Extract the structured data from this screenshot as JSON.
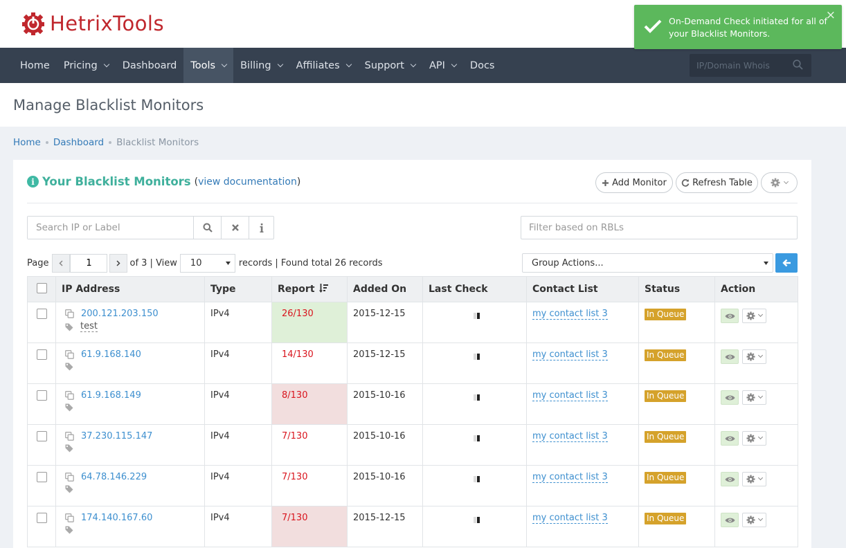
{
  "brand": {
    "name": "HetrixTools",
    "primary_color": "#c0272d"
  },
  "nav": {
    "items": [
      {
        "label": "Home",
        "dropdown": false,
        "active": false
      },
      {
        "label": "Pricing",
        "dropdown": true,
        "active": false
      },
      {
        "label": "Dashboard",
        "dropdown": false,
        "active": false
      },
      {
        "label": "Tools",
        "dropdown": true,
        "active": true
      },
      {
        "label": "Billing",
        "dropdown": true,
        "active": false
      },
      {
        "label": "Affiliates",
        "dropdown": true,
        "active": false
      },
      {
        "label": "Support",
        "dropdown": true,
        "active": false
      },
      {
        "label": "API",
        "dropdown": true,
        "active": false
      },
      {
        "label": "Docs",
        "dropdown": false,
        "active": false
      }
    ],
    "search_placeholder": "IP/Domain Whois"
  },
  "toast": {
    "message": "On-Demand Check initiated for all of your Blacklist Monitors.",
    "close": "×",
    "color": "#5cb85c"
  },
  "page": {
    "title": "Manage Blacklist Monitors"
  },
  "breadcrumb": {
    "home": "Home",
    "dashboard": "Dashboard",
    "current": "Blacklist Monitors"
  },
  "panel": {
    "title": "Your Blacklist Monitors",
    "doc_open": "(",
    "doc_link": "view documentation",
    "doc_close": ")",
    "add_monitor": "Add Monitor",
    "refresh_table": "Refresh Table",
    "search_placeholder": "Search IP or Label",
    "rbl_placeholder": "Filter based on RBLs"
  },
  "pager": {
    "page_label": "Page",
    "current_page": "1",
    "total_text": "of 3 | View",
    "per_page": "10",
    "records_text": "records | Found total 26 records",
    "group_actions": "Group Actions..."
  },
  "table": {
    "headers": {
      "ip": "IP Address",
      "type": "Type",
      "report": "Report",
      "added": "Added On",
      "last_check": "Last Check",
      "contact": "Contact List",
      "status": "Status",
      "action": "Action"
    },
    "rows": [
      {
        "ip": "200.121.203.150",
        "label": "test",
        "type": "IPv4",
        "report": "26/130",
        "report_bg": "green",
        "added": "2015-12-15",
        "contact": "my contact list 3",
        "status": "In Queue"
      },
      {
        "ip": "61.9.168.140",
        "label": "",
        "type": "IPv4",
        "report": "14/130",
        "report_bg": "none",
        "added": "2015-12-15",
        "contact": "my contact list 3",
        "status": "In Queue"
      },
      {
        "ip": "61.9.168.149",
        "label": "",
        "type": "IPv4",
        "report": "8/130",
        "report_bg": "red",
        "added": "2015-10-16",
        "contact": "my contact list 3",
        "status": "In Queue"
      },
      {
        "ip": "37.230.115.147",
        "label": "",
        "type": "IPv4",
        "report": "7/130",
        "report_bg": "none",
        "added": "2015-10-16",
        "contact": "my contact list 3",
        "status": "In Queue"
      },
      {
        "ip": "64.78.146.229",
        "label": "",
        "type": "IPv4",
        "report": "7/130",
        "report_bg": "none",
        "added": "2015-10-16",
        "contact": "my contact list 3",
        "status": "In Queue"
      },
      {
        "ip": "174.140.167.60",
        "label": "",
        "type": "IPv4",
        "report": "7/130",
        "report_bg": "red",
        "added": "2015-12-15",
        "contact": "my contact list 3",
        "status": "In Queue"
      }
    ]
  }
}
